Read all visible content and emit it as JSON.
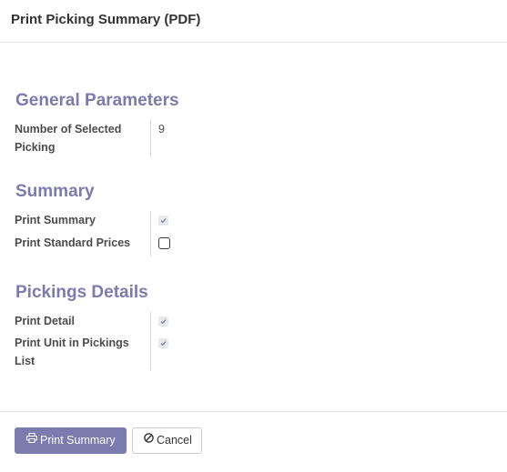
{
  "dialog": {
    "title": "Print Picking Summary (PDF)"
  },
  "sections": {
    "general": {
      "title": "General Parameters",
      "number_label": "Number of Selected Picking",
      "number_value": "9"
    },
    "summary": {
      "title": "Summary",
      "print_summary_label": "Print Summary",
      "print_summary_checked": true,
      "print_standard_prices_label": "Print Standard Prices",
      "print_standard_prices_checked": false
    },
    "details": {
      "title": "Pickings Details",
      "print_detail_label": "Print Detail",
      "print_detail_checked": true,
      "print_unit_label": "Print Unit in Pickings List",
      "print_unit_checked": true
    }
  },
  "footer": {
    "print_button_label": "Print Summary",
    "print_button_icon": "print-icon",
    "cancel_button_label": "Cancel",
    "cancel_button_icon": "ban-icon"
  },
  "colors": {
    "accent": "#7c7bad",
    "checkbox_checked_bg": "#e7e9ed"
  }
}
